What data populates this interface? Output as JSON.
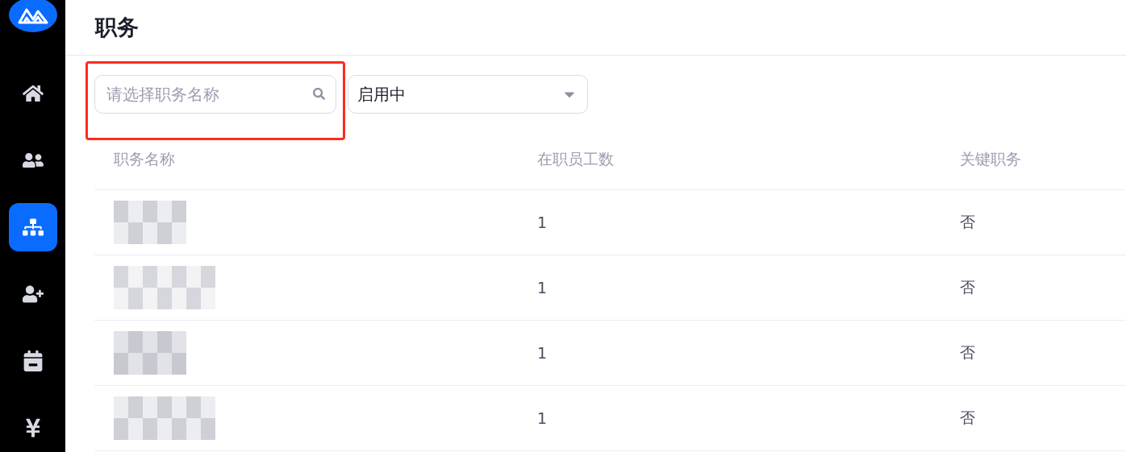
{
  "sidebar": {
    "items": [
      {
        "kind": "home",
        "selected": false
      },
      {
        "kind": "people",
        "selected": false
      },
      {
        "kind": "org",
        "selected": true
      },
      {
        "kind": "person-add",
        "selected": false
      },
      {
        "kind": "calendar",
        "selected": false
      },
      {
        "kind": "yen",
        "selected": false
      }
    ]
  },
  "page_title": "职务",
  "filters": {
    "search": {
      "placeholder": "请选择职务名称",
      "highlighted": true
    },
    "status_select": {
      "value": "启用中"
    }
  },
  "table": {
    "columns": [
      "职务名称",
      "在职员工数",
      "关键职务"
    ],
    "rows": [
      {
        "name_redacted": true,
        "employees": "1",
        "key_position": "否"
      },
      {
        "name_redacted": true,
        "employees": "1",
        "key_position": "否"
      },
      {
        "name_redacted": true,
        "employees": "1",
        "key_position": "否"
      },
      {
        "name_redacted": true,
        "employees": "1",
        "key_position": "否"
      }
    ]
  }
}
